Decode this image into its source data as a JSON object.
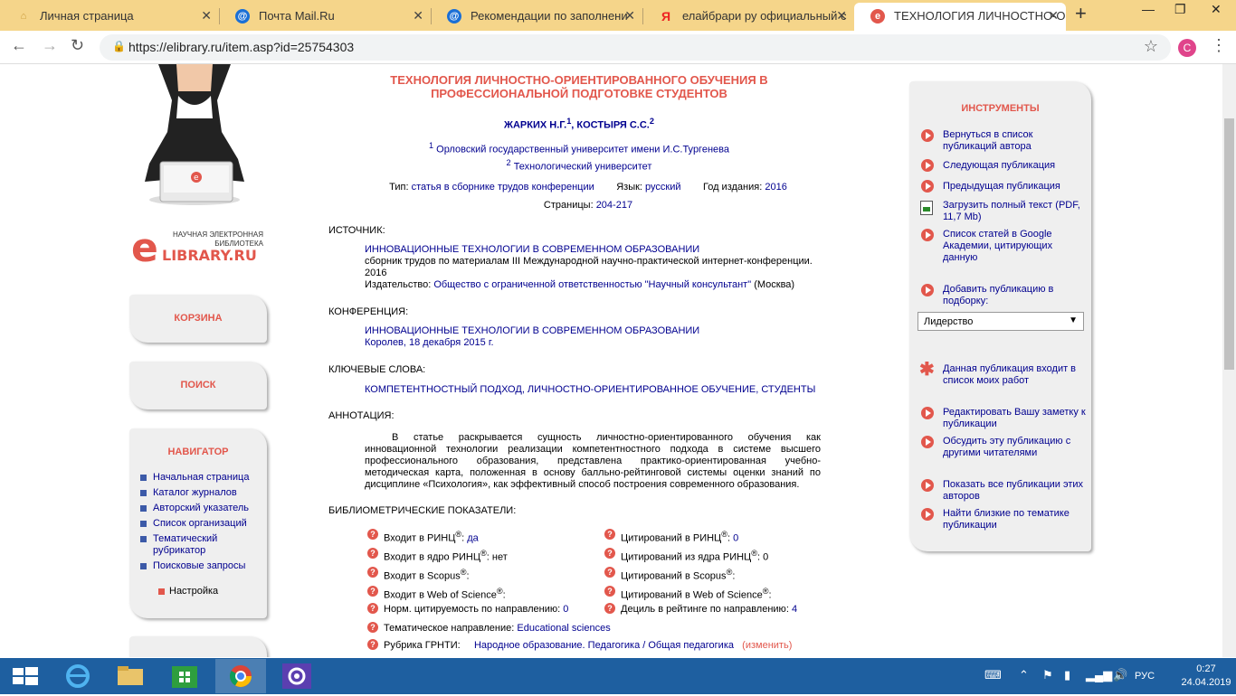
{
  "browser": {
    "tabs": [
      {
        "title": "Личная страница",
        "icon": "home-icon"
      },
      {
        "title": "Почта Mail.Ru",
        "icon": "at-icon"
      },
      {
        "title": "Рекомендации по заполнени",
        "icon": "at-icon"
      },
      {
        "title": "елайбрари ру официальный с",
        "icon": "yandex-icon"
      },
      {
        "title": "ТЕХНОЛОГИЯ ЛИЧНОСТНО-О",
        "icon": "elibrary-icon"
      }
    ],
    "new_tab": "+",
    "url": "https://elibrary.ru/item.asp?id=25754303",
    "avatar_letter": "C"
  },
  "logo": {
    "top_text": "НАУЧНАЯ ЭЛЕКТРОННАЯ БИБЛИОТЕКА",
    "big_letter": "e",
    "brand": "LIBRARY.RU"
  },
  "left": {
    "cart": "КОРЗИНА",
    "search": "ПОИСК",
    "navigator_title": "НАВИГАТОР",
    "nav_items": [
      "Начальная страница",
      "Каталог журналов",
      "Авторский указатель",
      "Список организаций",
      "Тематический рубрикатор",
      "Поисковые запросы"
    ],
    "settings": "Настройка"
  },
  "publication": {
    "title": "ТЕХНОЛОГИЯ ЛИЧНОСТНО-ОРИЕНТИРОВАННОГО ОБУЧЕНИЯ В ПРОФЕССИОНАЛЬНОЙ ПОДГОТОВКЕ СТУДЕНТОВ",
    "author1": "ЖАРКИХ Н.Г.",
    "author1_sup": "1",
    "author_sep": ", ",
    "author2": "КОСТЫРЯ С.С.",
    "author2_sup": "2",
    "affil1_sup": "1",
    "affil1": "Орловский государственный университет имени И.С.Тургенева",
    "affil2_sup": "2",
    "affil2": "Технологический университет",
    "type_label": "Тип:",
    "type_value": "статья в сборнике трудов конференции",
    "lang_label": "Язык:",
    "lang_value": "русский",
    "year_label": "Год издания:",
    "year_value": "2016",
    "pages_label": "Страницы:",
    "pages_value": "204-217",
    "source_label": "ИСТОЧНИК:",
    "source_title": "ИННОВАЦИОННЫЕ ТЕХНОЛОГИИ В СОВРЕМЕННОМ ОБРАЗОВАНИИ",
    "source_desc": "сборник трудов по материалам III Международной научно-практической интернет-конференции.",
    "source_year": "2016",
    "publisher_label": "Издательство:",
    "publisher_value": "Общество с ограниченной ответственностью \"Научный консультант\"",
    "publisher_city": "(Москва)",
    "conf_label": "КОНФЕРЕНЦИЯ:",
    "conf_title": "ИННОВАЦИОННЫЕ ТЕХНОЛОГИИ В СОВРЕМЕННОМ ОБРАЗОВАНИИ",
    "conf_place": "Королев, 18 декабря 2015 г.",
    "keywords_label": "КЛЮЧЕВЫЕ СЛОВА:",
    "keywords": "КОМПЕТЕНТНОСТНЫЙ ПОДХОД, ЛИЧНОСТНО-ОРИЕНТИРОВАННОЕ ОБУЧЕНИЕ, СТУДЕНТЫ",
    "abstract_label": "АННОТАЦИЯ:",
    "abstract": "В статье раскрывается сущность личностно-ориентированного обучения как инновационной технологии реализации компетентностного подхода в системе высшего профессионального образования, представлена практико-ориентированная учебно- методическая карта, положенная в основу балльно-рейтинговой системы оценки знаний по дисциплине «Психология», как эффективный способ построения современного образования.",
    "biblio_label": "БИБЛИОМЕТРИЧЕСКИЕ ПОКАЗАТЕЛИ:"
  },
  "biblio": [
    {
      "label": "Входит в РИНЦ",
      "reg": "®",
      "sep": ": ",
      "value": "да"
    },
    {
      "label": "Цитирований в РИНЦ",
      "reg": "®",
      "sep": ": ",
      "value": "0"
    },
    {
      "label": "Входит в ядро РИНЦ",
      "reg": "®",
      "sep": ": ",
      "value": "нет"
    },
    {
      "label": "Цитирований из ядра РИНЦ",
      "reg": "®",
      "sep": ": ",
      "value": "0"
    },
    {
      "label": "Входит в Scopus",
      "reg": "®",
      "sep": ":",
      "value": ""
    },
    {
      "label": "Цитирований в Scopus",
      "reg": "®",
      "sep": ":",
      "value": ""
    },
    {
      "label": "Входит в Web of Science",
      "reg": "®",
      "sep": ":",
      "value": ""
    },
    {
      "label": "Цитирований в Web of Science",
      "reg": "®",
      "sep": ":",
      "value": ""
    },
    {
      "label": "Норм. цитируемость по направлению",
      "reg": "",
      "sep": ": ",
      "value": "0"
    },
    {
      "label": "Дециль в рейтинге по направлению",
      "reg": "",
      "sep": ": ",
      "value": "4"
    },
    {
      "label": "Тематическое направление",
      "reg": "",
      "sep": ": ",
      "value": "Educational sciences"
    },
    {
      "label": "Рубрика ГРНТИ",
      "reg": "",
      "sep": ":",
      "value": "Народное образование. Педагогика / Общая педагогика",
      "extra": "(изменить)"
    }
  ],
  "tools": {
    "title": "ИНСТРУМЕНТЫ",
    "items": [
      "Вернуться в список публикаций автора",
      "Следующая публикация",
      "Предыдущая публикация",
      "Загрузить полный текст (PDF, 11,7 Mb)",
      "Список статей в Google Академии, цитирующих данную",
      "Добавить публикацию в подборку:",
      "Данная публикация входит в список моих работ",
      "Редактировать Вашу заметку к публикации",
      "Обсудить эту публикацию с другими читателями",
      "Показать все публикации этих авторов",
      "Найти близкие по тематике публикации"
    ],
    "select_value": "Лидерство"
  },
  "taskbar": {
    "lang": "РУС",
    "time": "0:27",
    "date": "24.04.2019"
  }
}
